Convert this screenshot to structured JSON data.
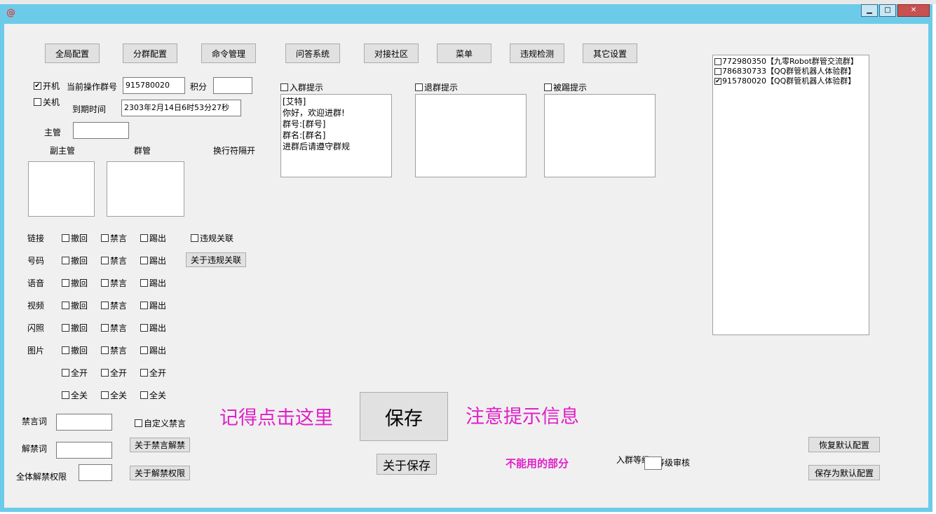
{
  "window": {
    "logo_icon": "at-sign-icon",
    "minimize_glyph": "▁",
    "maximize_glyph": "□",
    "close_glyph": "✕"
  },
  "toolbar": {
    "buttons": [
      "全局配置",
      "分群配置",
      "命令管理",
      "问答系统",
      "对接社区",
      "菜单",
      "违规检测",
      "其它设置"
    ]
  },
  "status": {
    "on_label": "开机",
    "off_label": "关机",
    "current_group_label": "当前操作群号",
    "current_group_value": "915780020",
    "points_label": "积分",
    "points_value": "",
    "expire_label": "到期时间",
    "expire_value": "2303年2月14日6时53分27秒",
    "admin_label": "主管",
    "admin_value": ""
  },
  "managers": {
    "deputy_label": "副主管",
    "group_admin_label": "群管",
    "newline_label": "换行符隔开"
  },
  "prompts": {
    "join_label": "入群提示",
    "join_text": "[艾特]\n你好，欢迎进群!\n群号:[群号]\n群名:[群名]\n进群后请遵守群规",
    "leave_label": "退群提示",
    "leave_text": "",
    "kicked_label": "被踢提示",
    "kicked_text": ""
  },
  "violations": {
    "rows": [
      "链接",
      "号码",
      "语音",
      "视频",
      "闪照",
      "图片"
    ],
    "recall": "撤回",
    "mute": "禁言",
    "kick": "踢出",
    "all_on": "全开",
    "all_off": "全关",
    "link_label": "违规关联",
    "about_link_button": "关于违规关联"
  },
  "words": {
    "ban_label": "禁言词",
    "ban_value": "",
    "unban_label": "解禁词",
    "unban_value": "",
    "all_unban_label": "全体解禁权限",
    "all_unban_value": "",
    "custom_ban_label": "自定义禁言",
    "about_ban_button": "关于禁言解禁",
    "about_unban_button": "关于解禁权限"
  },
  "save": {
    "save_button": "保存",
    "about_save_button": "关于保存",
    "remember_note": "记得点击这里",
    "notice_note": "注意提示信息",
    "unusable_note": "不能用的部分",
    "join_level_label": "入群等级",
    "level_review_label": "等级审核",
    "join_level_value": "",
    "accent_color": "#e020c8"
  },
  "group_list": {
    "items": [
      {
        "checked": false,
        "text": "772980350【九零Robot群管交流群】"
      },
      {
        "checked": false,
        "text": "786830733【QQ群管机器人体验群】"
      },
      {
        "checked": true,
        "text": "915780020【QQ群管机器人体验群】"
      }
    ]
  },
  "defaults": {
    "restore_button": "恢复默认配置",
    "save_default_button": "保存为默认配置"
  }
}
